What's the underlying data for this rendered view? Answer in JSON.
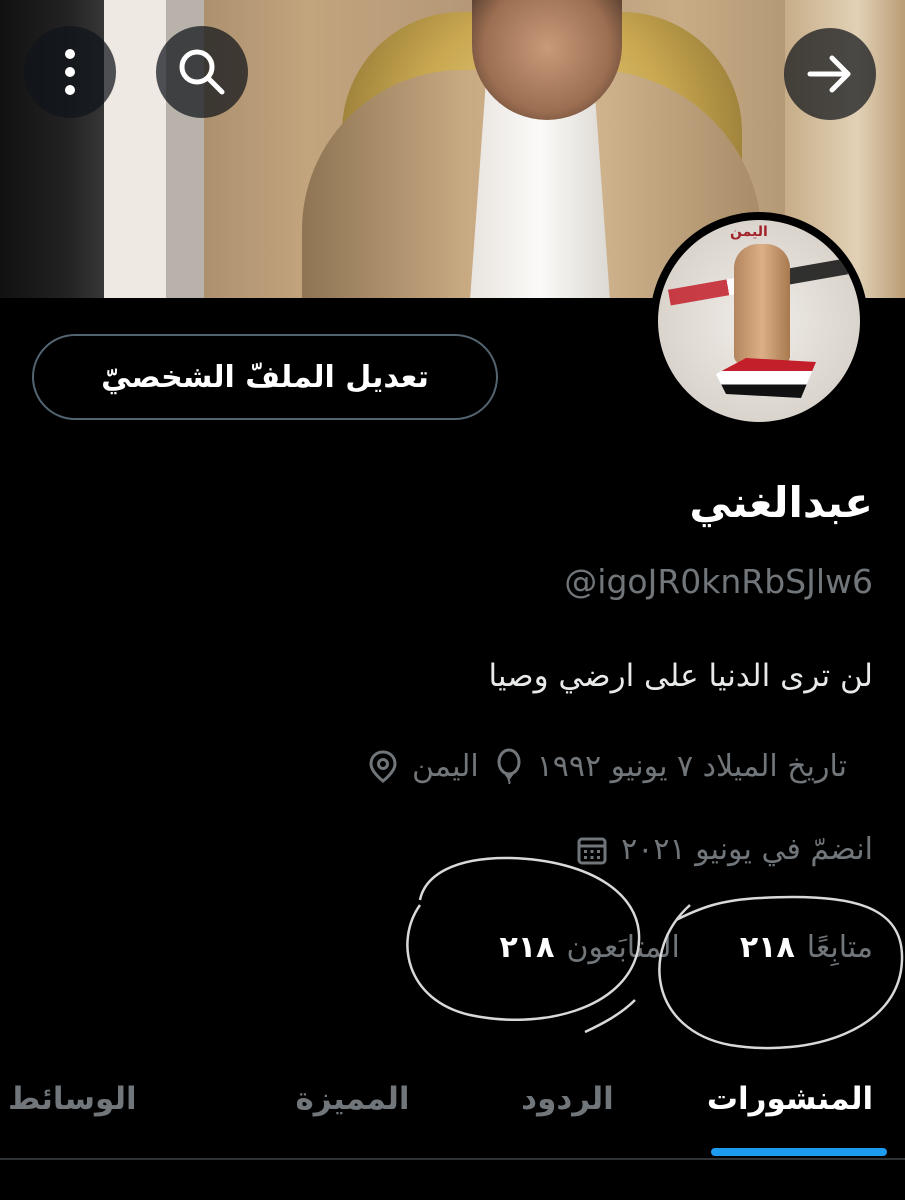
{
  "header": {
    "more_icon": "more-vertical-icon",
    "search_icon": "search-icon",
    "forward_icon": "arrow-right-icon"
  },
  "avatar": {
    "title_text": "اليمن"
  },
  "profile": {
    "edit_button_label": "تعديل الملفّ الشخصيّ",
    "display_name": "عبدالغني",
    "handle": "@igoJR0knRbSJlw6",
    "bio": "لن ترى الدنيا على ارضي وصيا",
    "location": "اليمن",
    "birthdate": "تاريخ الميلاد ٧ يونيو ١٩٩٢",
    "joined": "انضمّ في يونيو ٢٠٢١"
  },
  "stats": {
    "followers_count": "٢١٨",
    "followers_label": "المتابَعون",
    "following_count": "٢١٨",
    "following_label": "متابِعًا"
  },
  "tabs": [
    {
      "label": "المنشورات",
      "active": true
    },
    {
      "label": "الردود",
      "active": false
    },
    {
      "label": "المميزة",
      "active": false
    },
    {
      "label": "الوسائط",
      "active": false
    }
  ],
  "colors": {
    "background": "#000000",
    "primary_text": "#e7e9ea",
    "secondary_text": "#71767b",
    "accent": "#1d9bf0",
    "border": "#536471"
  }
}
